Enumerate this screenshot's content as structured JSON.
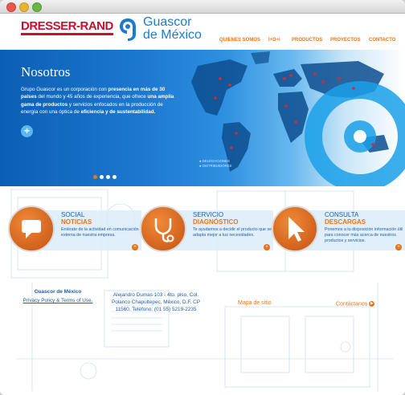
{
  "header": {
    "brand_left": "DRESSER-RAND",
    "brand_right_line1": "Guascor",
    "brand_right_line2": "de México",
    "nav": [
      "QUIENES SOMOS",
      "I+D+i",
      "PRODUCTOS",
      "PROYECTOS",
      "CONTACTO"
    ]
  },
  "hero": {
    "title": "Nosotros",
    "text_1": "Grupo Guascor es un corporación con ",
    "text_2_bold": "presencia en más de 30 países",
    "text_3": " del mundo y 45 años de experiencia, que ofrece ",
    "text_4_bold": "una amplia gama de productos",
    "text_5": " y servicios enfocados en la producción de energía con una óptica de ",
    "text_6_bold": "eficiencia y de sustentabilidad.",
    "plus": "+",
    "legend_1": "● DELEGACIONES",
    "legend_2": "● DISTRIBUIDORES",
    "slides": 4,
    "active_slide": 1
  },
  "features": [
    {
      "title": "SOCIAL",
      "subtitle": "NOTICIAS",
      "desc": "Entérate de la actividad en comunicación externa de nuestra empresa.",
      "icon": "speech-bubble-icon"
    },
    {
      "title": "SERVICIO",
      "subtitle": "DIAGNÓSTICO",
      "desc": "Te ayudamos a decidir el producto que se adapta mejor a tus necesidades.",
      "icon": "stethoscope-icon"
    },
    {
      "title": "CONSULTA",
      "subtitle": "DESCARGAS",
      "desc": "Ponemos a tu disposición información útil para conocer más acerca de nuestros productos y servicios.",
      "icon": "cursor-icon"
    }
  ],
  "footer": {
    "company": "Guascor de México",
    "privacy": "Privacy Policy & Terms of Use.",
    "address_1": "Alejandro Dumas 103 - 4to. piso, Col.",
    "address_2": "Polanco Chapultepec, México, D.F. CP",
    "address_3": "11560. Teléfono: (01 55) 5219-2235",
    "sitemap": "Mapa de sitio",
    "contact": "Contáctanos"
  },
  "colors": {
    "orange": "#e8731a",
    "blue": "#1d5fa8",
    "red": "#c8102e"
  }
}
